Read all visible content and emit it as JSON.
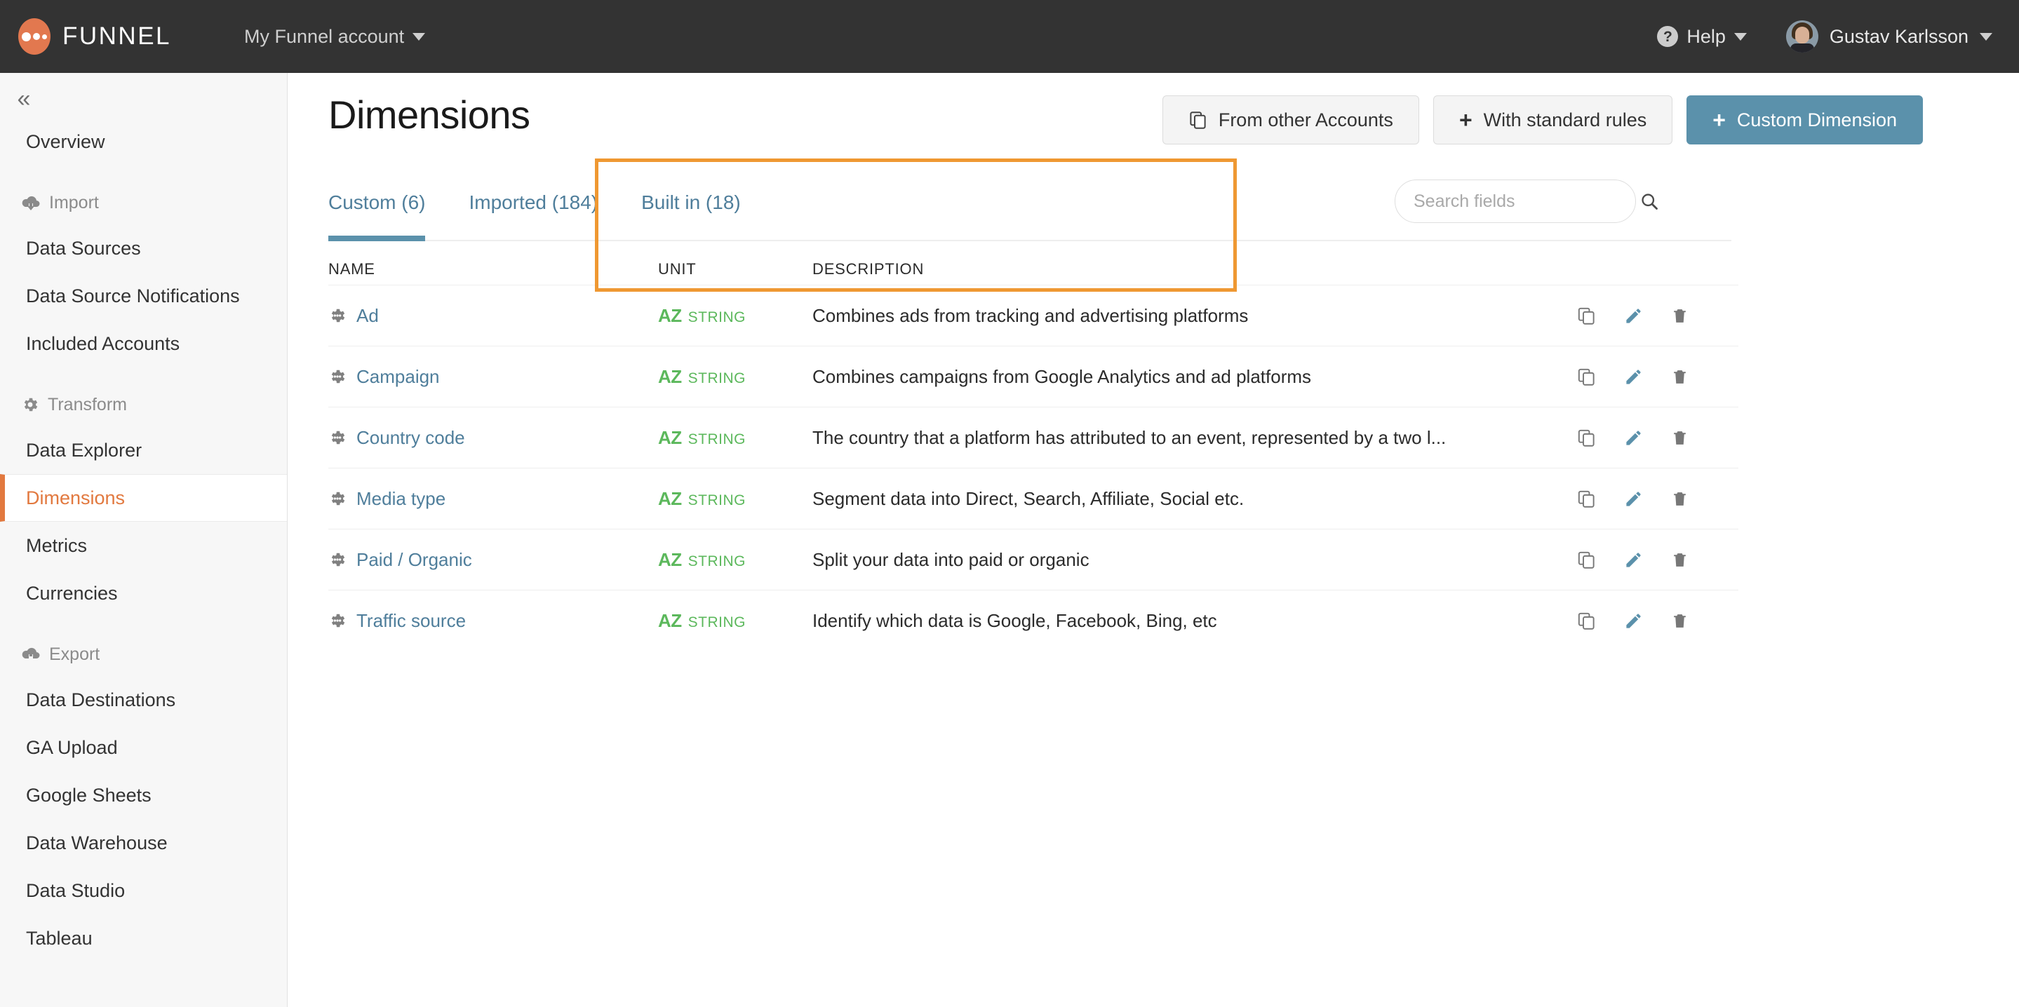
{
  "topbar": {
    "brand_name": "FUNNEL",
    "logo_icon": "funnel-dots-logo",
    "account_switcher": "My Funnel account",
    "help_label": "Help",
    "help_icon": "question-circle-icon",
    "user_name": "Gustav Karlsson",
    "avatar_icon": "user-avatar-photo",
    "caret_icon": "chevron-down-icon"
  },
  "sidebar": {
    "collapse_icon": "double-chevron-left-icon",
    "items": [
      {
        "label": "Overview",
        "type": "link",
        "active": false
      },
      {
        "label": "Import",
        "type": "group",
        "icon": "cloud-download-icon"
      },
      {
        "label": "Data Sources",
        "type": "link",
        "active": false
      },
      {
        "label": "Data Source Notifications",
        "type": "link",
        "active": false
      },
      {
        "label": "Included Accounts",
        "type": "link",
        "active": false
      },
      {
        "label": "Transform",
        "type": "group",
        "icon": "gear-icon"
      },
      {
        "label": "Data Explorer",
        "type": "link",
        "active": false
      },
      {
        "label": "Dimensions",
        "type": "link",
        "active": true
      },
      {
        "label": "Metrics",
        "type": "link",
        "active": false
      },
      {
        "label": "Currencies",
        "type": "link",
        "active": false
      },
      {
        "label": "Export",
        "type": "group",
        "icon": "cloud-upload-icon"
      },
      {
        "label": "Data Destinations",
        "type": "link",
        "active": false
      },
      {
        "label": "GA Upload",
        "type": "link",
        "active": false
      },
      {
        "label": "Google Sheets",
        "type": "link",
        "active": false
      },
      {
        "label": "Data Warehouse",
        "type": "link",
        "active": false
      },
      {
        "label": "Data Studio",
        "type": "link",
        "active": false
      },
      {
        "label": "Tableau",
        "type": "link",
        "active": false
      }
    ]
  },
  "page": {
    "title": "Dimensions",
    "actions": [
      {
        "label": "From other Accounts",
        "icon": "copy-icon",
        "style": "default"
      },
      {
        "label": "With standard rules",
        "icon": "plus-icon",
        "style": "default"
      },
      {
        "label": "Custom Dimension",
        "icon": "plus-icon",
        "style": "primary"
      }
    ]
  },
  "tabs": [
    {
      "label": "Custom (6)",
      "active": true
    },
    {
      "label": "Imported (184)",
      "active": false
    },
    {
      "label": "Built in (18)",
      "active": false
    }
  ],
  "search": {
    "placeholder": "Search fields",
    "value": "",
    "icon": "search-icon"
  },
  "table": {
    "columns": [
      "NAME",
      "UNIT",
      "DESCRIPTION"
    ],
    "row_icon": "custom-dimension-gear-icon",
    "row_actions": [
      {
        "name": "duplicate",
        "icon": "copy-icon"
      },
      {
        "name": "edit",
        "icon": "pencil-icon"
      },
      {
        "name": "delete",
        "icon": "trash-icon"
      }
    ],
    "rows": [
      {
        "name": "Ad",
        "unit_az": "AZ",
        "unit_type": "STRING",
        "description": "Combines ads from tracking and advertising platforms"
      },
      {
        "name": "Campaign",
        "unit_az": "AZ",
        "unit_type": "STRING",
        "description": "Combines campaigns from Google Analytics and ad platforms"
      },
      {
        "name": "Country code",
        "unit_az": "AZ",
        "unit_type": "STRING",
        "description": "The country that a platform has attributed to an event, represented by a two l..."
      },
      {
        "name": "Media type",
        "unit_az": "AZ",
        "unit_type": "STRING",
        "description": "Segment data into Direct, Search, Affiliate, Social etc."
      },
      {
        "name": "Paid / Organic",
        "unit_az": "AZ",
        "unit_type": "STRING",
        "description": "Split your data into paid or organic"
      },
      {
        "name": "Traffic source",
        "unit_az": "AZ",
        "unit_type": "STRING",
        "description": "Identify which data is Google, Facebook, Bing, etc"
      }
    ]
  },
  "annotation": {
    "shape": "rectangle-highlight",
    "color": "#ef9832",
    "target": "tabs"
  },
  "colors": {
    "brand_orange": "#e2784f",
    "accent_teal": "#5b91ab",
    "topbar_dark": "#333333",
    "sidebar_bg": "#f7f7f7",
    "unit_green": "#5cb85c",
    "annotation_orange": "#ef9832"
  }
}
